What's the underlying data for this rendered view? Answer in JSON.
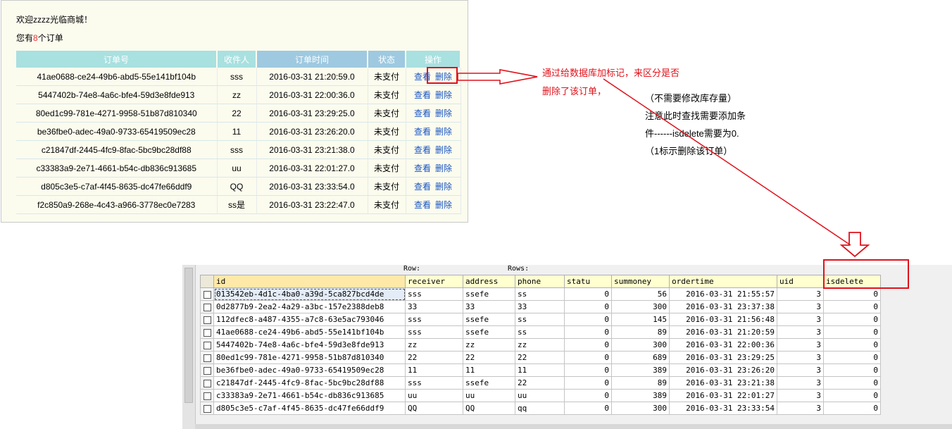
{
  "shop": {
    "welcome": "欢迎zzzz光临商城！",
    "count_prefix": "您有",
    "count": "8",
    "count_suffix": "个订单",
    "headers": [
      "订单号",
      "收件人",
      "订单时间",
      "状态",
      "操作"
    ],
    "view_label": "查看",
    "delete_label": "删除",
    "orders": [
      {
        "id": "41ae0688-ce24-49b6-abd5-55e141bf104b",
        "receiver": "sss",
        "time": "2016-03-31 21:20:59.0",
        "status": "未支付"
      },
      {
        "id": "5447402b-74e8-4a6c-bfe4-59d3e8fde913",
        "receiver": "zz",
        "time": "2016-03-31 22:00:36.0",
        "status": "未支付"
      },
      {
        "id": "80ed1c99-781e-4271-9958-51b87d810340",
        "receiver": "22",
        "time": "2016-03-31 23:29:25.0",
        "status": "未支付"
      },
      {
        "id": "be36fbe0-adec-49a0-9733-65419509ec28",
        "receiver": "11",
        "time": "2016-03-31 23:26:20.0",
        "status": "未支付"
      },
      {
        "id": "c21847df-2445-4fc9-8fac-5bc9bc28df88",
        "receiver": "sss",
        "time": "2016-03-31 23:21:38.0",
        "status": "未支付"
      },
      {
        "id": "c33383a9-2e71-4661-b54c-db836c913685",
        "receiver": "uu",
        "time": "2016-03-31 22:01:27.0",
        "status": "未支付"
      },
      {
        "id": "d805c3e5-c7af-4f45-8635-dc47fe66ddf9",
        "receiver": "QQ",
        "time": "2016-03-31 23:33:54.0",
        "status": "未支付"
      },
      {
        "id": "f2c850a9-268e-4c43-a966-3778ec0e7283",
        "receiver": "ss是",
        "time": "2016-03-31 23:22:47.0",
        "status": "未支付"
      }
    ]
  },
  "annotations": {
    "red_line1": "通过给数据库加标记，来区分是否",
    "red_line2": "删除了该订单，",
    "black_line1": "（不需要修改库存量）",
    "black_line2": "注意此时查找需要添加条",
    "black_line3": "件------isdelete需要为0.",
    "black_line4": "（1标示删除该订单）"
  },
  "db": {
    "row_label": "Row:",
    "rows_label": "Rows:",
    "columns": [
      "id",
      "receiver",
      "address",
      "phone",
      "statu",
      "summoney",
      "ordertime",
      "uid",
      "isdelete"
    ],
    "rows": [
      [
        "013542eb-4d1c-4ba0-a39d-5ca827bcd4de",
        "sss",
        "ssefe",
        "ss",
        "0",
        "56",
        "2016-03-31 21:55:57",
        "3",
        "0"
      ],
      [
        "0d2877b9-2ea2-4a29-a3bc-157e2388deb8",
        "33",
        "33",
        "33",
        "0",
        "300",
        "2016-03-31 23:37:38",
        "3",
        "0"
      ],
      [
        "112dfec8-a487-4355-a7c8-63e5ac793046",
        "sss",
        "ssefe",
        "ss",
        "0",
        "145",
        "2016-03-31 21:56:48",
        "3",
        "0"
      ],
      [
        "41ae0688-ce24-49b6-abd5-55e141bf104b",
        "sss",
        "ssefe",
        "ss",
        "0",
        "89",
        "2016-03-31 21:20:59",
        "3",
        "0"
      ],
      [
        "5447402b-74e8-4a6c-bfe4-59d3e8fde913",
        "zz",
        "zz",
        "zz",
        "0",
        "300",
        "2016-03-31 22:00:36",
        "3",
        "0"
      ],
      [
        "80ed1c99-781e-4271-9958-51b87d810340",
        "22",
        "22",
        "22",
        "0",
        "689",
        "2016-03-31 23:29:25",
        "3",
        "0"
      ],
      [
        "be36fbe0-adec-49a0-9733-65419509ec28",
        "11",
        "11",
        "11",
        "0",
        "389",
        "2016-03-31 23:26:20",
        "3",
        "0"
      ],
      [
        "c21847df-2445-4fc9-8fac-5bc9bc28df88",
        "sss",
        "ssefe",
        "22",
        "0",
        "89",
        "2016-03-31 23:21:38",
        "3",
        "0"
      ],
      [
        "c33383a9-2e71-4661-b54c-db836c913685",
        "uu",
        "uu",
        "uu",
        "0",
        "389",
        "2016-03-31 22:01:27",
        "3",
        "0"
      ],
      [
        "d805c3e5-c7af-4f45-8635-dc47fe66ddf9",
        "QQ",
        "QQ",
        "qq",
        "0",
        "300",
        "2016-03-31 23:33:54",
        "3",
        "0"
      ]
    ]
  }
}
